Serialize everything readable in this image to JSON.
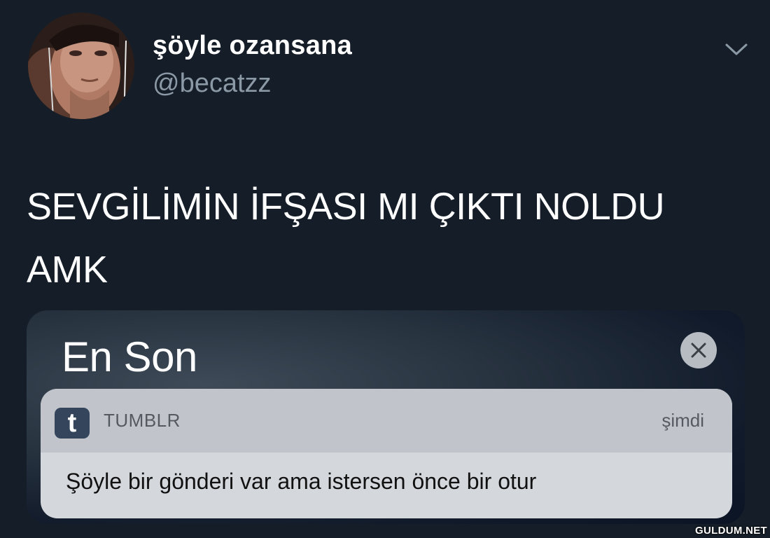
{
  "tweet": {
    "display_name": "şöyle ozansana",
    "handle": "@becatzz",
    "text": "SEVGİLİMİN İFŞASI MI ÇIKTI NOLDU\nAMK",
    "menu_icon": "chevron-down-icon"
  },
  "notification_center": {
    "title": "En Son",
    "close_icon": "close-icon",
    "notification": {
      "app_icon_glyph": "t",
      "app_name": "TUMBLR",
      "time": "şimdi",
      "message": "Şöyle bir gönderi var ama istersen önce bir otur"
    }
  },
  "watermark": "GULDUM.NET",
  "colors": {
    "background": "#151e28",
    "handle_gray": "#8b98a5",
    "tumblr_blue": "#35465c",
    "notification_bg": "#d4d7dc"
  }
}
